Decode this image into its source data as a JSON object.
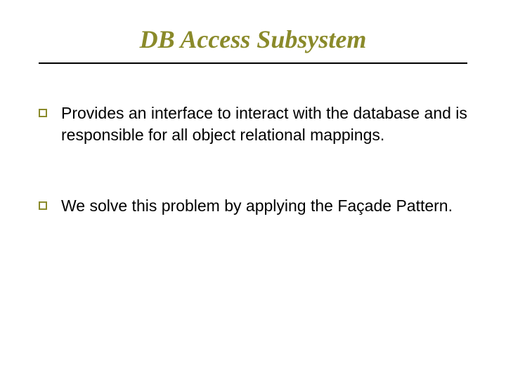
{
  "title": "DB Access Subsystem",
  "bullets": [
    "Provides an interface to interact with the database and is responsible for all object relational mappings.",
    "We solve this problem by applying the Façade Pattern."
  ]
}
